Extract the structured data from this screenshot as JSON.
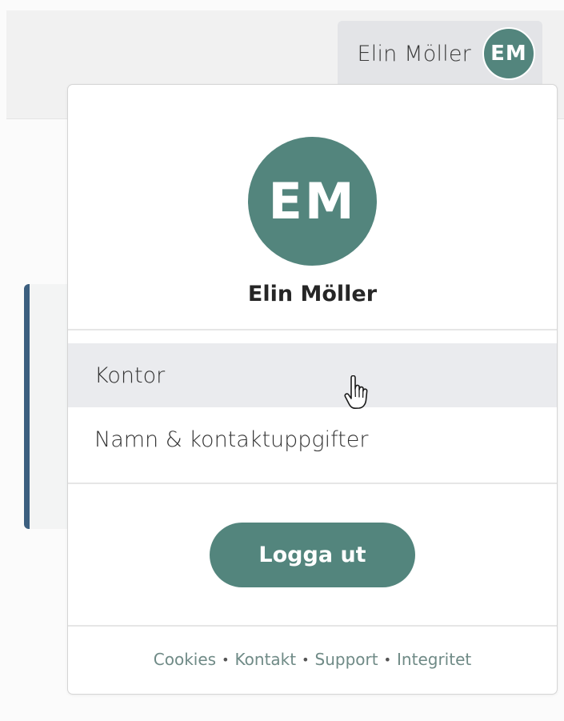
{
  "header": {
    "user_name": "Elin Möller",
    "initials": "EM"
  },
  "dropdown": {
    "initials": "EM",
    "user_name": "Elin Möller",
    "menu_items": [
      {
        "label": "Kontor"
      },
      {
        "label": "Namn & kontaktuppgifter"
      }
    ],
    "logout_label": "Logga ut",
    "footer_links": [
      "Cookies",
      "Kontakt",
      "Support",
      "Integritet"
    ],
    "footer_separator": "•"
  },
  "colors": {
    "accent": "#53857d",
    "side_accent": "#3c5f7f",
    "hover_bg": "#eaebee"
  },
  "icons": {
    "cursor": "hand-pointer-icon"
  }
}
